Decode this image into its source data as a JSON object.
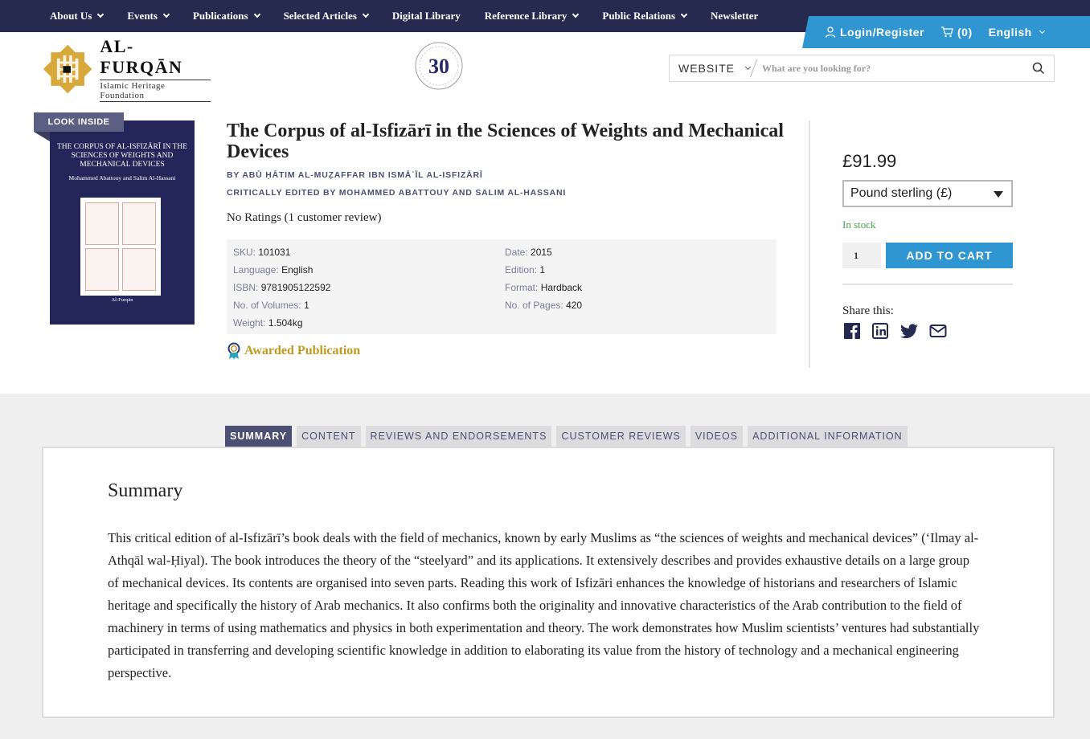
{
  "nav": {
    "items": [
      {
        "label": "About Us",
        "dropdown": true
      },
      {
        "label": "Events",
        "dropdown": true
      },
      {
        "label": "Publications",
        "dropdown": true
      },
      {
        "label": "Selected Articles",
        "dropdown": true
      },
      {
        "label": "Digital Library",
        "dropdown": false
      },
      {
        "label": "Reference Library",
        "dropdown": true
      },
      {
        "label": "Public Relations",
        "dropdown": true
      },
      {
        "label": "Newsletter",
        "dropdown": false
      }
    ]
  },
  "account": {
    "login_label": "Login/Register",
    "cart_count": "(0)",
    "language": "English"
  },
  "logo": {
    "title": "AL-FURQĀN",
    "subtitle": "Islamic Heritage Foundation"
  },
  "search": {
    "scope": "WEBSITE",
    "placeholder": "What are you looking for?"
  },
  "product": {
    "look_inside": "LOOK INSIDE",
    "cover": {
      "title": "The Corpus of al-Isfizārī in the Sciences of Weights and Mechanical Devices",
      "authors": "Mohammed Abattouy and Salim Al-Hassani",
      "publisher": "Al-Furqān"
    },
    "title": "The Corpus of al-Isfizārī in the Sciences of Weights and Mechanical Devices",
    "byline": "BY ABŪ ḤĀTIM AL-MUẒAFFAR IBN ISMĀʿĪL AL-ISFIZĀRĪ",
    "editors": "CRITICALLY EDITED BY MOHAMMED ABATTOUY AND SALIM AL-HASSANI",
    "rating_text": "No Ratings (1 customer review)",
    "attributes": {
      "sku": {
        "label": "SKU:",
        "value": "101031"
      },
      "date": {
        "label": "Date:",
        "value": "2015"
      },
      "language": {
        "label": "Language:",
        "value": "English"
      },
      "edition": {
        "label": "Edition:",
        "value": "1"
      },
      "isbn": {
        "label": "ISBN:",
        "value": "9781905122592"
      },
      "format": {
        "label": "Format:",
        "value": "Hardback"
      },
      "volumes": {
        "label": "No. of Volumes:",
        "value": "1"
      },
      "pages": {
        "label": "No. of Pages:",
        "value": "420"
      },
      "weight": {
        "label": "Weight:",
        "value": "1.504kg"
      }
    },
    "award": "Awarded Publication"
  },
  "purchase": {
    "price": "£91.99",
    "currency": "Pound sterling (£)",
    "stock": "In stock",
    "quantity": "1",
    "add_to_cart": "ADD TO CART",
    "share_label": "Share this:",
    "share_icons": [
      "facebook-icon",
      "linkedin-icon",
      "twitter-icon",
      "email-icon"
    ]
  },
  "tabs": [
    {
      "label": "SUMMARY",
      "active": true
    },
    {
      "label": "CONTENT",
      "active": false
    },
    {
      "label": "REVIEWS AND ENDORSEMENTS",
      "active": false
    },
    {
      "label": "CUSTOMER REVIEWS",
      "active": false
    },
    {
      "label": "VIDEOS",
      "active": false
    },
    {
      "label": "ADDITIONAL INFORMATION",
      "active": false
    }
  ],
  "summary": {
    "heading": "Summary",
    "text": "This critical edition of al-Isfizārī’s book deals with the field of mechanics, known by early Muslims as “the sciences of weights and mechanical devices” (‘Ilmay al-Athqāl wal-Ḥiyal). The book introduces the theory of the “steelyard” and its applications. It extensively describes and provides exhaustive details on a large group of mechanical devices. Its contents are organised into seven parts. Reading this work of Isfizāri enhances the knowledge of historians and researchers of Islamic heritage and specifically the history of Arab mechanics. It also confirms both the originality and innovative characteristics of the Arab contribution to the field of machinery in terms of using mathematics and physics in both experimentation and theory. The work demonstrates how Muslim scientists’ ventures had substantially participated in transferring and developing scientific knowledge in addition to elaborating its value from the history of technology and a mechanical engineering perspective."
  },
  "colors": {
    "nav_bg": "#262a4f",
    "accent_blue": "#2f96d2",
    "label_purple": "#4b4f72",
    "award_gold": "#c09a1c",
    "stock_green": "#4aa34a"
  }
}
